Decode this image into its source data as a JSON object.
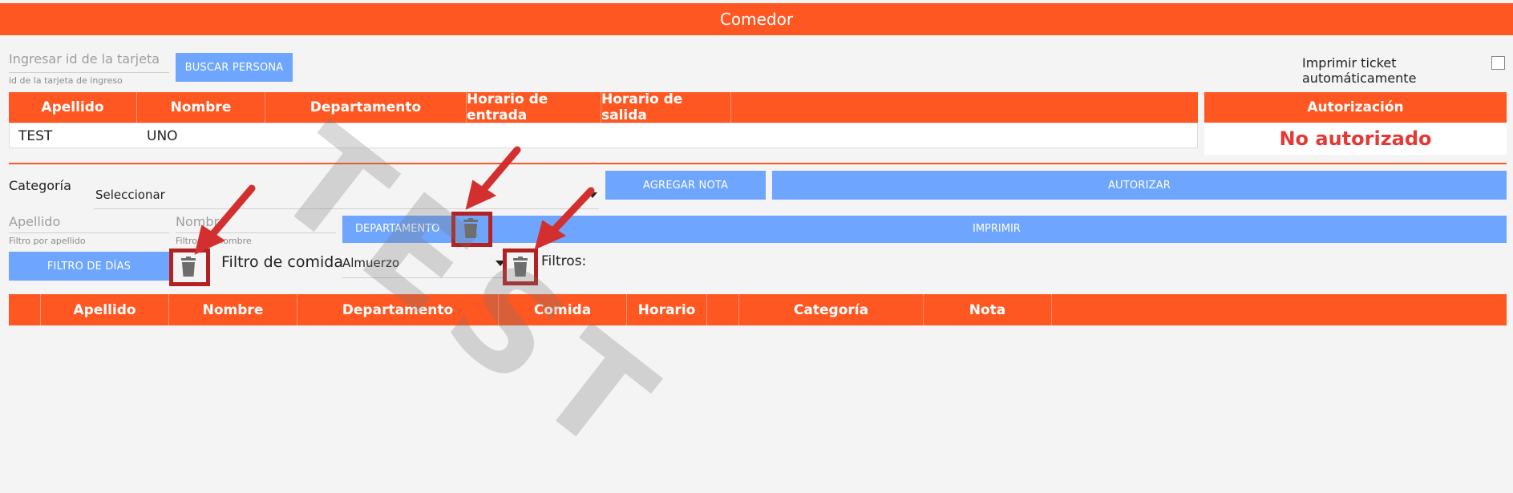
{
  "window": {
    "title": "Comedor"
  },
  "search": {
    "placeholder": "Ingresar id de la tarjeta",
    "hint": "id de la tarjeta de ingreso",
    "button": "BUSCAR PERSONA"
  },
  "auto_print": {
    "label": "Imprimir ticket automáticamente",
    "checked": false
  },
  "person_table": {
    "headers": [
      "Apellido",
      "Nombre",
      "Departamento",
      "Horario de entrada",
      "Horario de salida"
    ],
    "row": {
      "apellido": "TEST",
      "nombre": "UNO",
      "departamento": "",
      "entrada": "",
      "salida": ""
    }
  },
  "authorization": {
    "header": "Autorización",
    "status": "No autorizado",
    "status_color": "#e53935"
  },
  "category": {
    "label": "Categoría",
    "value": "Seleccionar"
  },
  "actions": {
    "add_note": "AGREGAR NOTA",
    "authorize": "AUTORIZAR",
    "department": "DEPARTAMENTO",
    "print": "IMPRIMIR"
  },
  "filters": {
    "apellido_placeholder": "Apellido",
    "apellido_hint": "Filtro por apellido",
    "nombre_placeholder": "Nombre",
    "nombre_hint": "Filtro por nombre",
    "days_button": "FILTRO DE DÍAS",
    "food_label": "Filtro de comida",
    "food_value": "Almuerzo",
    "filters_label": "Filtros:"
  },
  "log_table": {
    "headers": [
      "Apellido",
      "Nombre",
      "Departamento",
      "Comida",
      "Horario",
      "Categoría",
      "Nota"
    ]
  },
  "watermark": "TEST",
  "colors": {
    "accent": "#ff5722",
    "button": "#6ea6ff",
    "highlight": "#b22222"
  }
}
